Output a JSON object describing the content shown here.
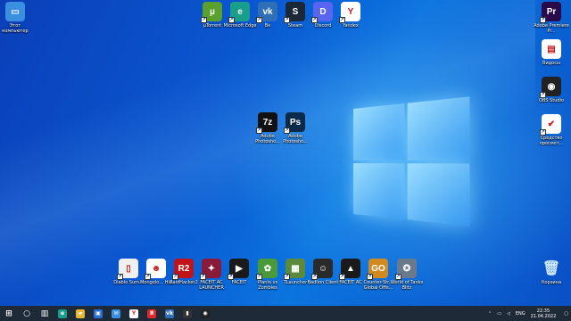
{
  "desktop_icons_top": [
    {
      "label": "Этот компьютер",
      "icon": "this-pc-icon",
      "color": "#3b8fe0",
      "glyph": "▭"
    },
    {
      "label": "µTorrent",
      "icon": "utorrent-icon",
      "color": "#5aa02c",
      "glyph": "µ"
    },
    {
      "label": "Microsoft Edge",
      "icon": "edge-icon",
      "color": "#1a9e8c",
      "glyph": "e"
    },
    {
      "label": "Вк",
      "icon": "vk-icon",
      "color": "#2f6fb8",
      "glyph": "vk"
    },
    {
      "label": "Steam",
      "icon": "steam-icon",
      "color": "#1b2838",
      "glyph": "S"
    },
    {
      "label": "Discord",
      "icon": "discord-icon",
      "color": "#5865f2",
      "glyph": "D"
    },
    {
      "label": "Yandex",
      "icon": "yandex-icon",
      "color": "#ffffff",
      "glyph": "Y"
    },
    {
      "label": "Adobe Premiere Pr...",
      "icon": "premiere-icon",
      "color": "#2a0a4a",
      "glyph": "Pr"
    }
  ],
  "desktop_icons_right": [
    {
      "label": "Видосы",
      "icon": "folder-icon",
      "color": "#ffffff",
      "glyph": "▤"
    },
    {
      "label": "OBS Studio",
      "icon": "obs-icon",
      "color": "#222222",
      "glyph": "◉"
    },
    {
      "label": "Средство просмот...",
      "icon": "viewer-icon",
      "color": "#ffffff",
      "glyph": "✔"
    }
  ],
  "desktop_icons_center": [
    {
      "label": "Adobe Photosho...",
      "icon": "7zip-icon",
      "color": "#111111",
      "glyph": "7z"
    },
    {
      "label": "Adobe Photosho...",
      "icon": "photoshop-icon",
      "color": "#0a2a4a",
      "glyph": "Ps"
    }
  ],
  "desktop_icons_bottom": [
    {
      "label": "Diablo Sum...",
      "icon": "document-icon",
      "color": "#f0f0f0",
      "glyph": "▯"
    },
    {
      "label": "Mongolo... Hip",
      "icon": "game-icon",
      "color": "#ffffff",
      "glyph": "☻"
    },
    {
      "label": "RaidHacker2",
      "icon": "r2-icon",
      "color": "#c0131a",
      "glyph": "R2"
    },
    {
      "label": "FACEIT AC LAUNCHER",
      "icon": "launcher-icon",
      "color": "#8a1a3a",
      "glyph": "✦"
    },
    {
      "label": "FACEIT",
      "icon": "faceit-icon",
      "color": "#1a1a1a",
      "glyph": "▶"
    },
    {
      "label": "Plants vs Zombies",
      "icon": "pvz-icon",
      "color": "#4a9a3a",
      "glyph": "✿"
    },
    {
      "label": "TLauncher",
      "icon": "minecraft-icon",
      "color": "#5a8a3a",
      "glyph": "▦"
    },
    {
      "label": "Badlion Client",
      "icon": "badlion-icon",
      "color": "#2a2a2a",
      "glyph": "☺"
    },
    {
      "label": "FACEIT AC",
      "icon": "faceit-ac-icon",
      "color": "#1a1a1a",
      "glyph": "▲"
    },
    {
      "label": "Counter-Str... Global Offe...",
      "icon": "csgo-icon",
      "color": "#d08a20",
      "glyph": "GO"
    },
    {
      "label": "World of Tanks Blitz",
      "icon": "wotb-icon",
      "color": "#6a7a8a",
      "glyph": "✪"
    }
  ],
  "recycle_bin": {
    "label": "Корзина",
    "icon": "recycle-bin-icon"
  },
  "taskbar": {
    "items": [
      {
        "name": "start-icon",
        "glyph": "⊞",
        "color": ""
      },
      {
        "name": "search-icon",
        "glyph": "○",
        "color": ""
      },
      {
        "name": "task-view-icon",
        "glyph": "▥",
        "color": ""
      },
      {
        "name": "edge-taskbar-icon",
        "glyph": "e",
        "color": "#1a9e8c"
      },
      {
        "name": "explorer-icon",
        "glyph": "▰",
        "color": "#e8b830"
      },
      {
        "name": "store-icon",
        "glyph": "▣",
        "color": "#2a6fd0"
      },
      {
        "name": "mail-icon",
        "glyph": "✉",
        "color": "#3b8fe0"
      },
      {
        "name": "yandex-taskbar-icon",
        "glyph": "Y",
        "color": "#ffffff"
      },
      {
        "name": "browser-taskbar-icon",
        "glyph": "Я",
        "color": "#e02a2a"
      },
      {
        "name": "vk-taskbar-icon",
        "glyph": "vk",
        "color": "#2f6fb8"
      },
      {
        "name": "terminal-icon",
        "glyph": "▮",
        "color": "#333333"
      },
      {
        "name": "obs-taskbar-icon",
        "glyph": "◉",
        "color": "#222222"
      }
    ],
    "tray": {
      "lang": "ENG",
      "time": "22:35",
      "date": "21.04.2022"
    }
  }
}
